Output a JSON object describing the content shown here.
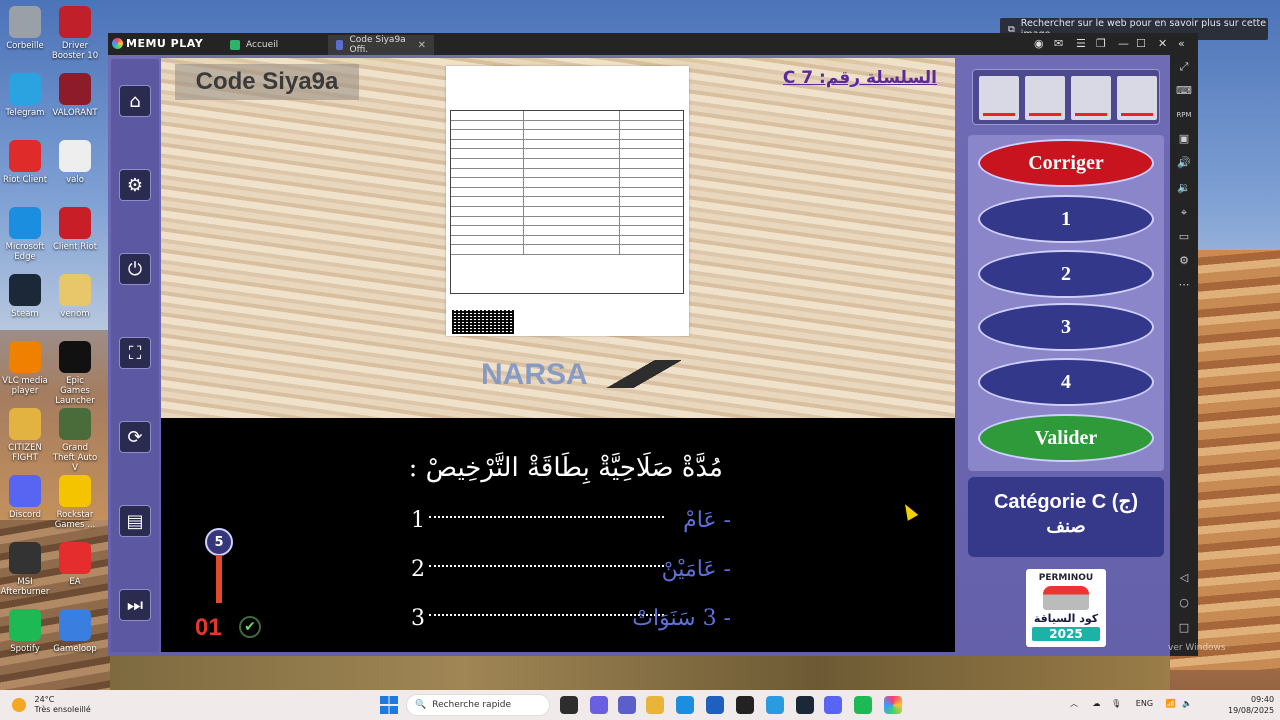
{
  "desktop": {
    "icons_left": [
      {
        "label": "Corbeille",
        "color": "#9aa0a8"
      },
      {
        "label": "Telegram",
        "color": "#2aa3e0"
      },
      {
        "label": "Riot Client",
        "color": "#e02b2b"
      },
      {
        "label": "Microsoft Edge",
        "color": "#1b8ee0"
      },
      {
        "label": "Steam",
        "color": "#1b2838"
      },
      {
        "label": "VLC media player",
        "color": "#f08000"
      },
      {
        "label": "CITIZEN FIGHT",
        "color": "#e3b341"
      },
      {
        "label": "Discord",
        "color": "#5865f2"
      },
      {
        "label": "MSI Afterburner",
        "color": "#333333"
      },
      {
        "label": "Spotify",
        "color": "#1db954"
      }
    ],
    "icons_right": [
      {
        "label": "Driver Booster 10",
        "color": "#c0202a"
      },
      {
        "label": "VALORANT",
        "color": "#8c1c2a"
      },
      {
        "label": "valo",
        "color": "#eeeeee"
      },
      {
        "label": "Client Riot",
        "color": "#c81e28"
      },
      {
        "label": "venom",
        "color": "#e8c76a"
      },
      {
        "label": "Epic Games Launcher",
        "color": "#111111"
      },
      {
        "label": "Grand Theft Auto V",
        "color": "#4a6b3a"
      },
      {
        "label": "Rockstar Games ...",
        "color": "#f5c400"
      },
      {
        "label": "EA",
        "color": "#e52d2d"
      },
      {
        "label": "Gameloop",
        "color": "#3a7fe0"
      }
    ],
    "search_hint": "Rechercher sur le web pour en savoir plus sur cette image",
    "watermark": "ver Windows"
  },
  "emulator": {
    "brand": "MEMU PLAY",
    "tabs": [
      {
        "label": "Accueil",
        "active": false
      },
      {
        "label": "Code Siya9a Offi.",
        "active": true
      }
    ]
  },
  "quiz": {
    "brand_title": "Code Siya9a",
    "series": "السلسلة رقم: C 7",
    "question": "مُدَّةْ صَلَاحِيَّةْ بِطَاقَةْ التَّرْخِيصْ :",
    "answers": [
      {
        "number": "1",
        "text": "- عَامْ"
      },
      {
        "number": "2",
        "text": "- عَامَيْنْ"
      },
      {
        "number": "3",
        "text": "- 3 سَنَوَاتْ"
      }
    ],
    "question_number": "5",
    "progress_fraction": 0.2,
    "answer_counter": "01",
    "narsa": "NARSA"
  },
  "right_panel": {
    "buttons": {
      "corriger": "Corriger",
      "opt1": "1",
      "opt2": "2",
      "opt3": "3",
      "opt4": "4",
      "valider": "Valider"
    },
    "category_line1": "Catégorie C (ج)",
    "category_line2": "صنف",
    "promo": {
      "brand": "PERMINOU",
      "subtitle": "كود السياقة",
      "year": "2025"
    }
  },
  "taskbar": {
    "temperature": "24°C",
    "weather": "Très ensoleillé",
    "search_placeholder": "Recherche rapide",
    "language": "ENG",
    "time": "09:40",
    "date": "19/08/2025"
  },
  "colors": {
    "accent_red": "#c8141e",
    "accent_blue": "#34388a",
    "accent_green": "#2f9a3a",
    "panel_purple": "#6f6bb5"
  }
}
